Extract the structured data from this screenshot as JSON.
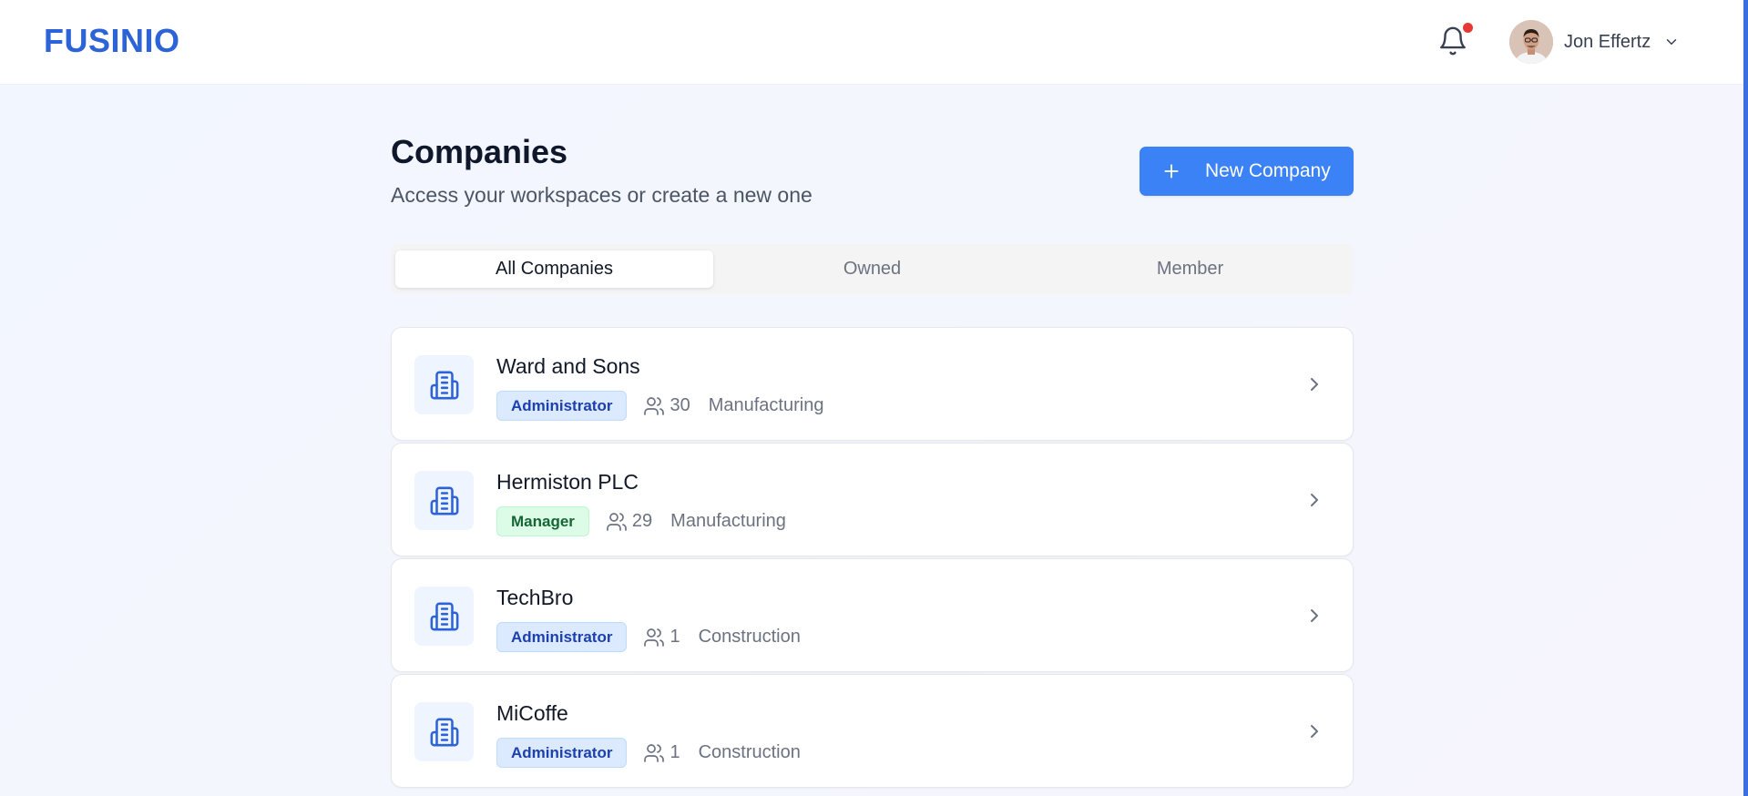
{
  "header": {
    "logo": "FUSINIO",
    "user_name": "Jon Effertz",
    "has_unread_notifications": true
  },
  "page": {
    "title": "Companies",
    "subtitle": "Access your workspaces or create a new one",
    "new_button_label": "New Company"
  },
  "tabs": [
    {
      "label": "All Companies",
      "active": true
    },
    {
      "label": "Owned",
      "active": false
    },
    {
      "label": "Member",
      "active": false
    }
  ],
  "companies": [
    {
      "name": "Ward and Sons",
      "role": "Administrator",
      "members": "30",
      "industry": "Manufacturing"
    },
    {
      "name": "Hermiston PLC",
      "role": "Manager",
      "members": "29",
      "industry": "Manufacturing"
    },
    {
      "name": "TechBro",
      "role": "Administrator",
      "members": "1",
      "industry": "Construction"
    },
    {
      "name": "MiCoffe",
      "role": "Administrator",
      "members": "1",
      "industry": "Construction"
    }
  ],
  "colors": {
    "brand": "#2d63d8",
    "primary_button": "#3b82f6",
    "notification_dot": "#e53935",
    "admin_badge_bg": "#dbeafe",
    "manager_badge_bg": "#dcfce7"
  },
  "icons": {
    "notification": "bell-icon",
    "user_menu": "chevron-down-icon",
    "new_company": "plus-icon",
    "company": "building-icon",
    "members": "users-icon",
    "open": "chevron-right-icon"
  }
}
